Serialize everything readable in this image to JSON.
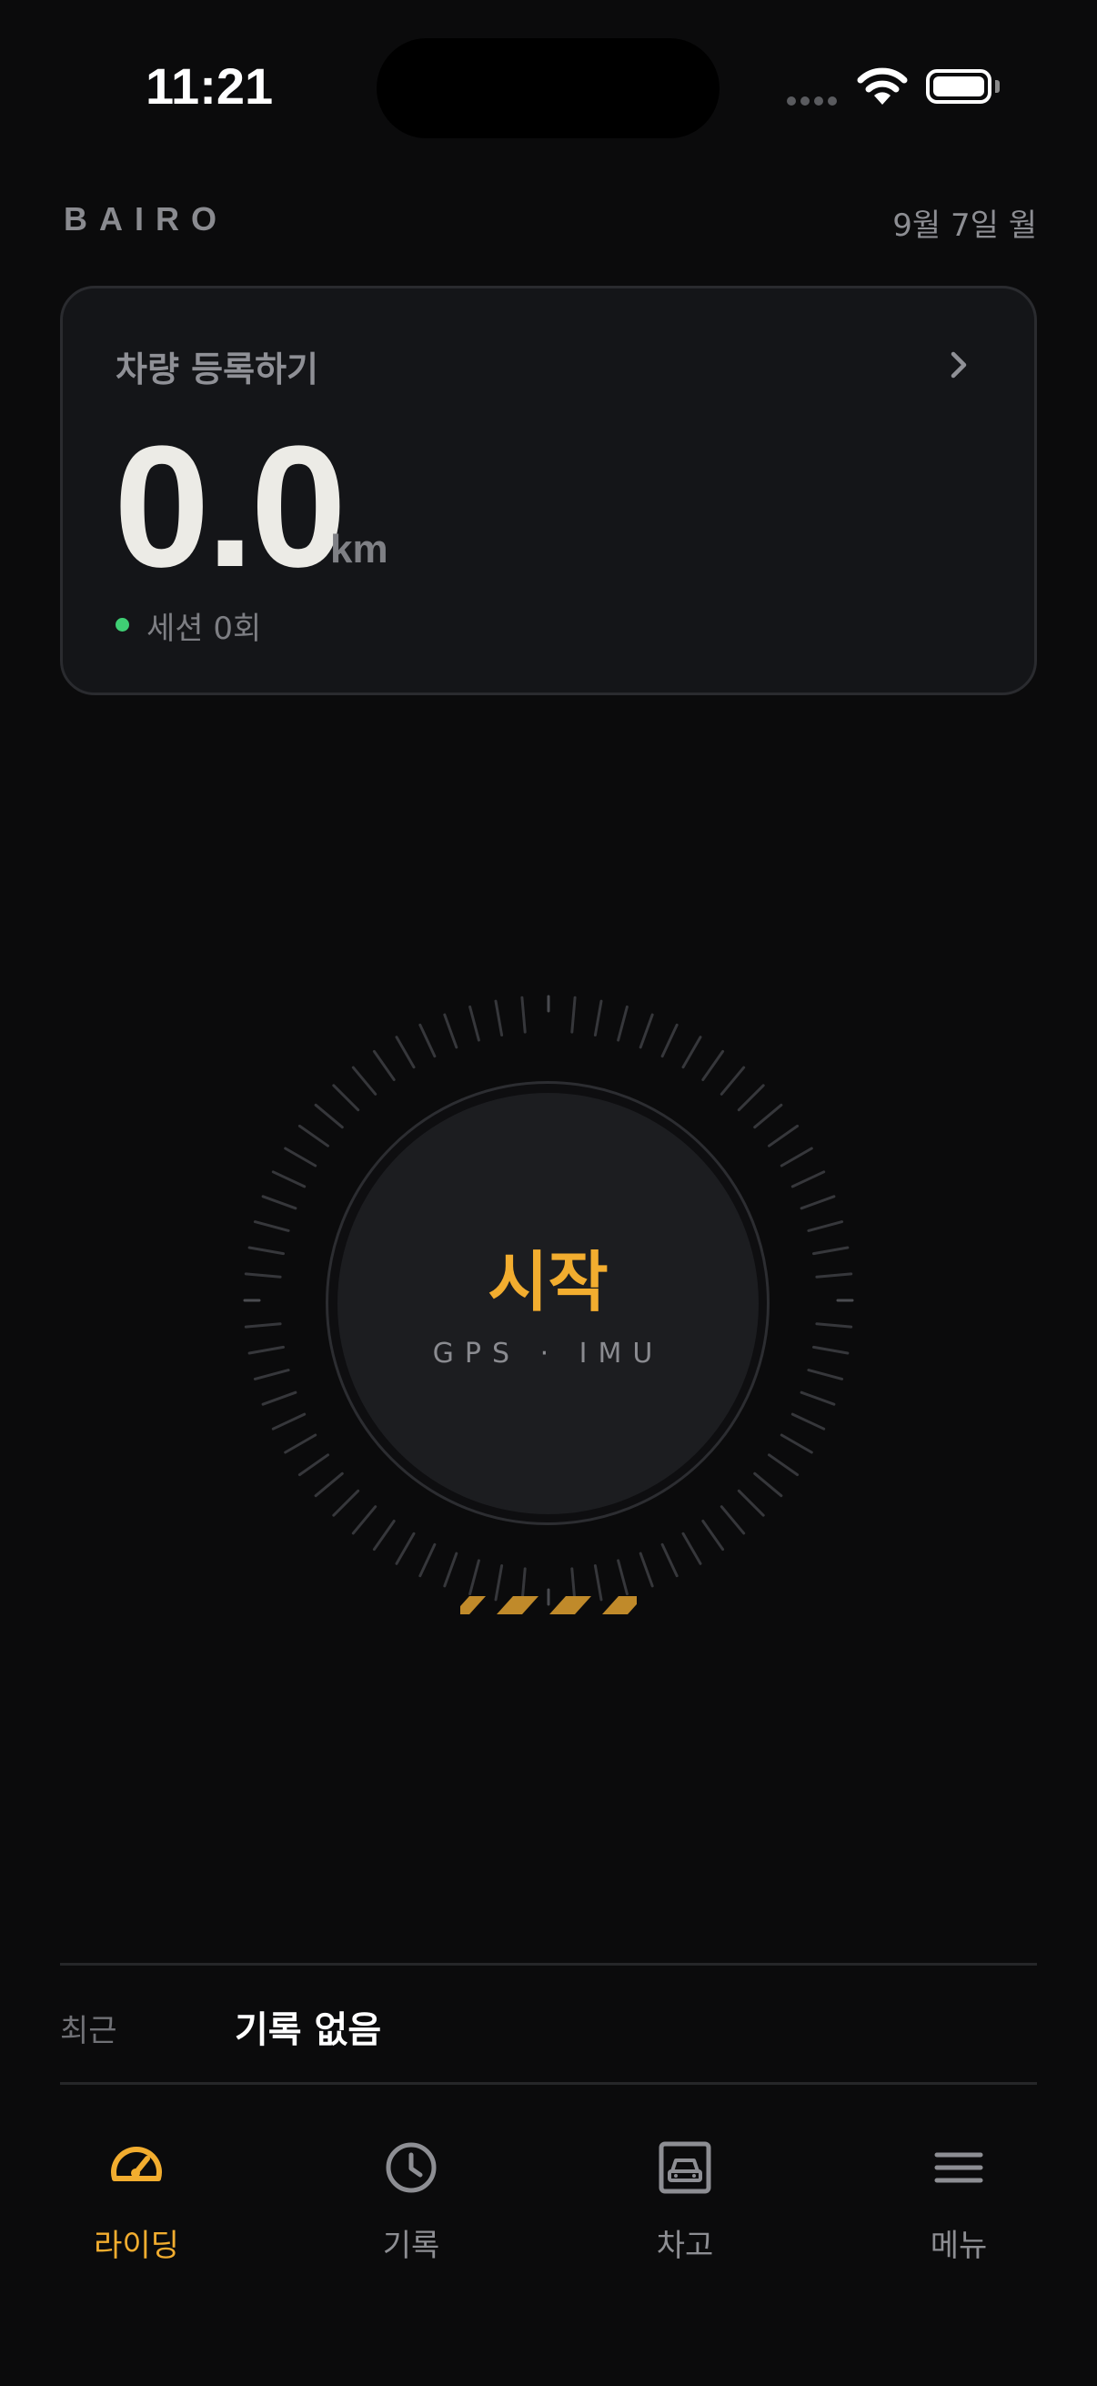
{
  "status_bar": {
    "time": "11:21"
  },
  "header": {
    "brand": "BAIRO",
    "date": "9월 7일 월"
  },
  "vehicle_card": {
    "title": "차량 등록하기",
    "distance_value": "0.0",
    "distance_unit": "km",
    "sessions": "세션 0회",
    "status_dot_color": "#3fcf74"
  },
  "start_dial": {
    "label": "시작",
    "sensors": "GPS · IMU",
    "accent_color": "#f2ad2f"
  },
  "recent": {
    "label": "최근",
    "value": "기록 없음"
  },
  "tab_bar": {
    "active_index": 0,
    "items": [
      {
        "label": "라이딩",
        "icon": "speedometer-icon"
      },
      {
        "label": "기록",
        "icon": "clock-icon"
      },
      {
        "label": "차고",
        "icon": "garage-car-icon"
      },
      {
        "label": "메뉴",
        "icon": "menu-icon"
      }
    ]
  }
}
